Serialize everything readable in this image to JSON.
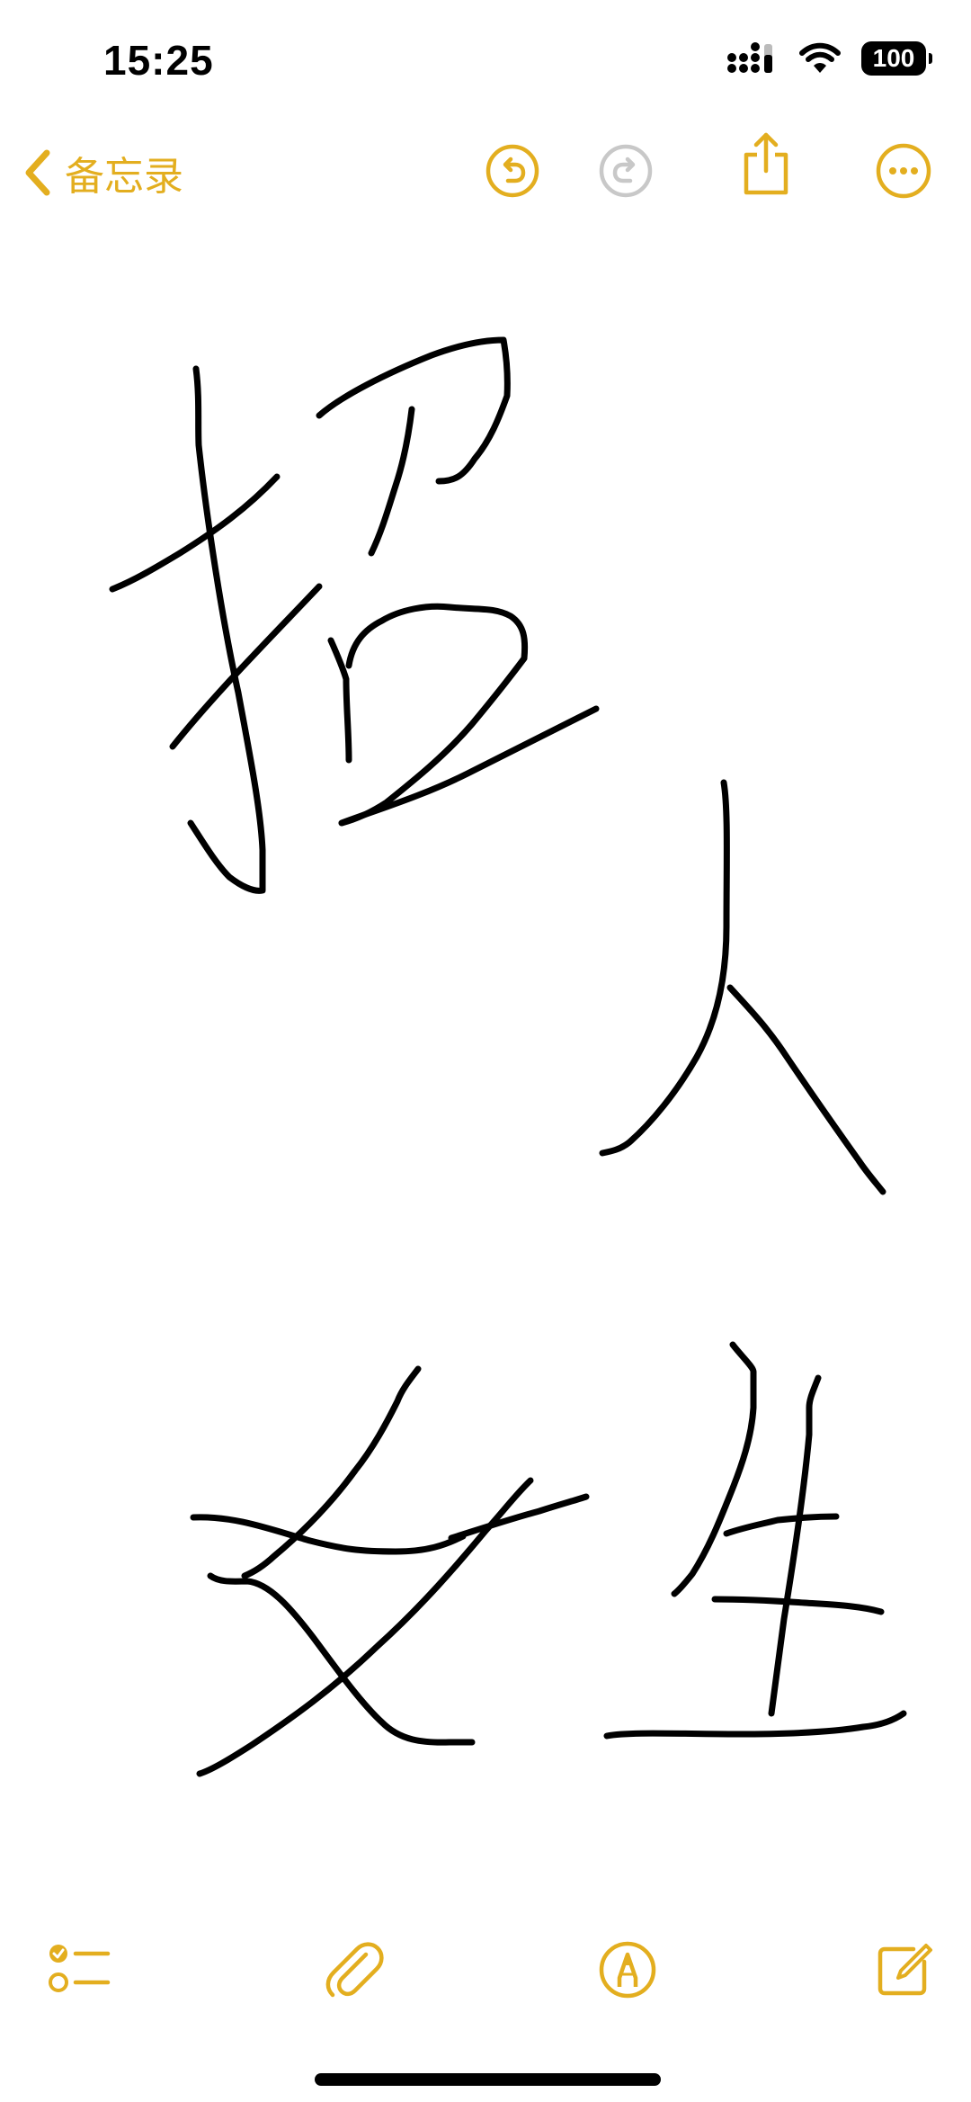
{
  "status_bar": {
    "time": "15:25",
    "battery": "100"
  },
  "nav": {
    "back_label": "备忘录"
  },
  "colors": {
    "accent": "#e3ae1f",
    "disabled": "#c8c8c8",
    "ink": "#000000"
  },
  "icons": {
    "back": "chevron-left-icon",
    "undo": "undo-icon",
    "redo": "redo-icon",
    "share": "share-icon",
    "more": "more-icon",
    "checklist": "checklist-icon",
    "attach": "paperclip-icon",
    "markup": "markup-pen-icon",
    "compose": "compose-icon"
  }
}
